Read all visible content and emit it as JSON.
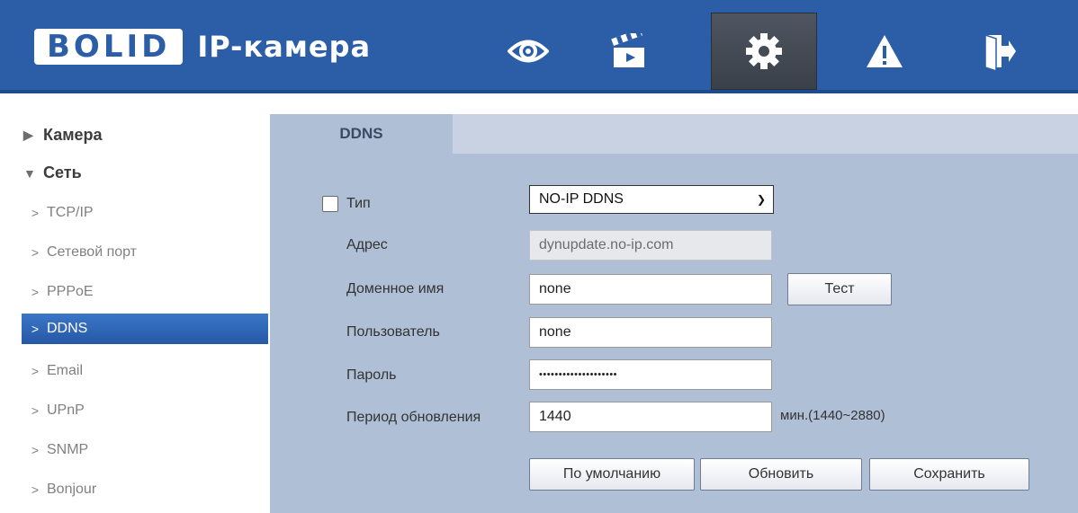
{
  "app": {
    "logo_text": "BOLID",
    "title": "IP-камера"
  },
  "topnav": [
    {
      "icon": "eye-icon",
      "label": "live-view"
    },
    {
      "icon": "clapperboard-icon",
      "label": "playback"
    },
    {
      "icon": "gear-icon",
      "label": "settings",
      "active": true
    },
    {
      "icon": "warning-icon",
      "label": "alarm"
    },
    {
      "icon": "exit-icon",
      "label": "logout"
    }
  ],
  "sidebar": {
    "groups": [
      {
        "label": "Камера",
        "expanded": false
      },
      {
        "label": "Сеть",
        "expanded": true
      }
    ],
    "items": [
      {
        "label": "TCP/IP",
        "selected": false
      },
      {
        "label": "Сетевой порт",
        "selected": false
      },
      {
        "label": "PPPoE",
        "selected": false
      },
      {
        "label": "DDNS",
        "selected": true
      },
      {
        "label": "Email",
        "selected": false
      },
      {
        "label": "UPnP",
        "selected": false
      },
      {
        "label": "SNMP",
        "selected": false
      },
      {
        "label": "Bonjour",
        "selected": false
      }
    ]
  },
  "tab": {
    "label": "DDNS"
  },
  "form": {
    "type_label": "Тип",
    "type_checked": false,
    "type_value": "NO-IP DDNS",
    "address_label": "Адрес",
    "address_value": "dynupdate.no-ip.com",
    "domain_label": "Доменное имя",
    "domain_value": "none",
    "test_button": "Тест",
    "user_label": "Пользователь",
    "user_value": "none",
    "password_label": "Пароль",
    "password_value": "••••••••••••••••••••",
    "period_label": "Период обновления",
    "period_value": "1440",
    "period_hint": "мин.(1440~2880)"
  },
  "buttons": {
    "default": "По умолчанию",
    "refresh": "Обновить",
    "save": "Сохранить"
  },
  "colors": {
    "header": "#2c5ea8",
    "selected": "#2f67b8",
    "panel": "#afbfd6",
    "tab_strip": "#c8d2e2"
  }
}
